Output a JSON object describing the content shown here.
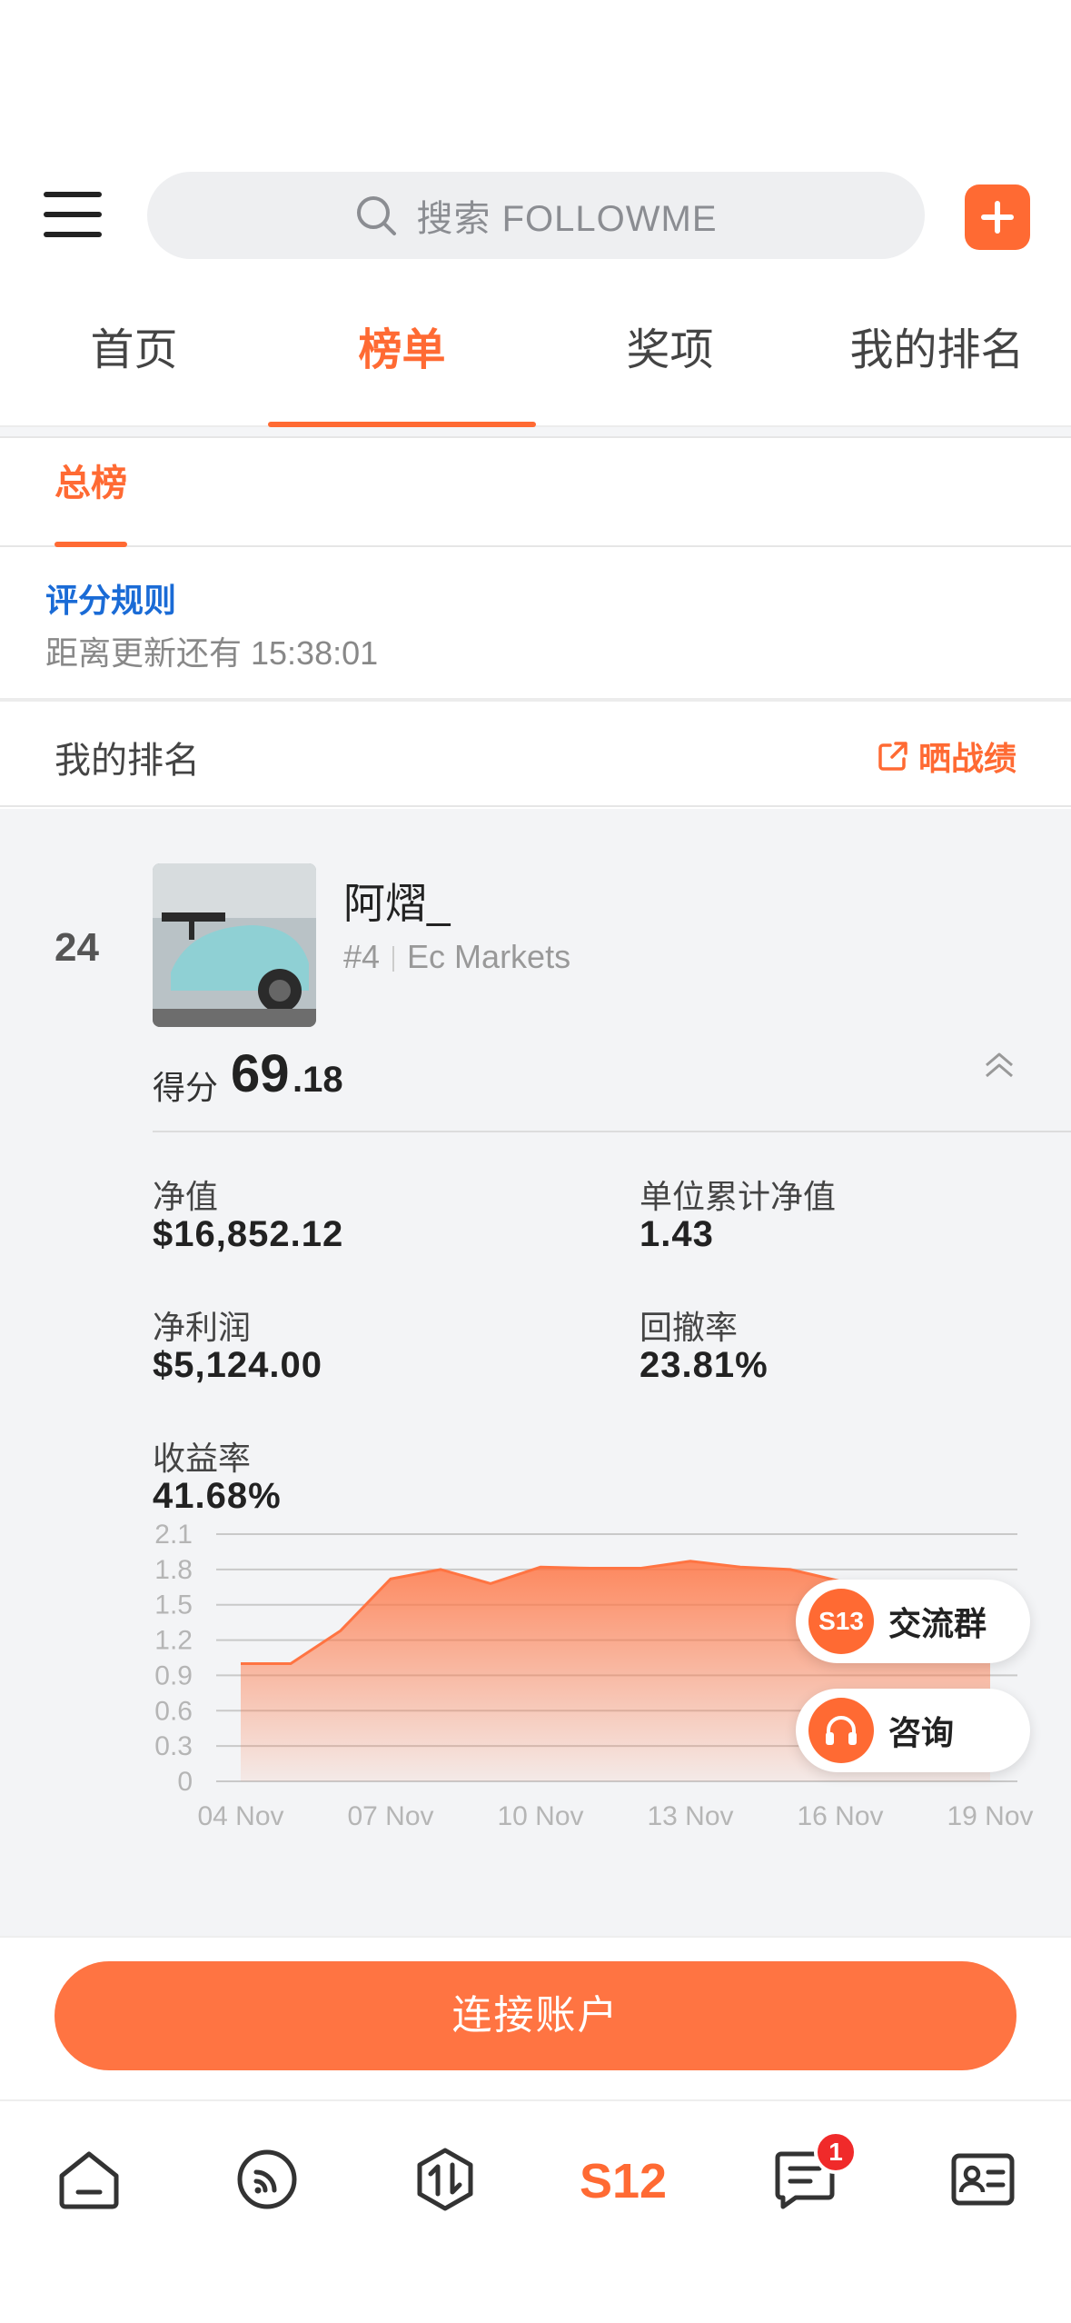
{
  "search": {
    "placeholder": "搜索 FOLLOWME"
  },
  "tabs": [
    {
      "label": "首页"
    },
    {
      "label": "榜单"
    },
    {
      "label": "奖项"
    },
    {
      "label": "我的排名"
    }
  ],
  "subtab": {
    "label": "总榜"
  },
  "rules": {
    "link": "评分规则",
    "countdown": "距离更新还有 15:38:01"
  },
  "my_rank": {
    "title": "我的排名",
    "share_label": "晒战绩"
  },
  "entry": {
    "rank": "24",
    "name": "阿熠_",
    "position": "#4",
    "broker": "Ec Markets",
    "score_label": "得分",
    "score_int": "69",
    "score_dec": ".18",
    "stats": {
      "net_value": {
        "label": "净值",
        "value": "$16,852.12"
      },
      "unit_nav": {
        "label": "单位累计净值",
        "value": "1.43"
      },
      "net_profit": {
        "label": "净利润",
        "value": "$5,124.00"
      },
      "drawdown": {
        "label": "回撤率",
        "value": "23.81%"
      },
      "return_rate": {
        "label": "收益率",
        "value": "41.68%"
      }
    }
  },
  "chart_data": {
    "type": "area",
    "x": [
      "04 Nov",
      "05 Nov",
      "06 Nov",
      "07 Nov",
      "08 Nov",
      "09 Nov",
      "10 Nov",
      "11 Nov",
      "12 Nov",
      "13 Nov",
      "14 Nov",
      "15 Nov",
      "16 Nov",
      "17 Nov",
      "18 Nov",
      "19 Nov"
    ],
    "values": [
      1.0,
      1.0,
      1.28,
      1.72,
      1.8,
      1.68,
      1.82,
      1.81,
      1.81,
      1.87,
      1.82,
      1.8,
      1.7,
      1.55,
      1.45,
      1.43
    ],
    "x_ticks": [
      "04 Nov",
      "07 Nov",
      "10 Nov",
      "13 Nov",
      "16 Nov",
      "19 Nov"
    ],
    "y_ticks": [
      "0",
      "0.3",
      "0.6",
      "0.9",
      "1.2",
      "1.5",
      "1.8",
      "2.1"
    ],
    "ylim": [
      0,
      2.1
    ],
    "grid": true,
    "color": "#ff7442"
  },
  "floating": [
    {
      "icon_text": "S13",
      "label": "交流群"
    },
    {
      "label": "咨询"
    }
  ],
  "cta": {
    "label": "连接账户"
  },
  "bottom_nav": {
    "items": [
      "home-icon",
      "feed-icon",
      "trade-icon",
      "s12-logo-icon",
      "messages-icon",
      "profile-card-icon"
    ],
    "messages_badge": "1",
    "s12_label": "S12"
  },
  "colors": {
    "accent": "#ff6a33",
    "link": "#1a6bd6"
  }
}
